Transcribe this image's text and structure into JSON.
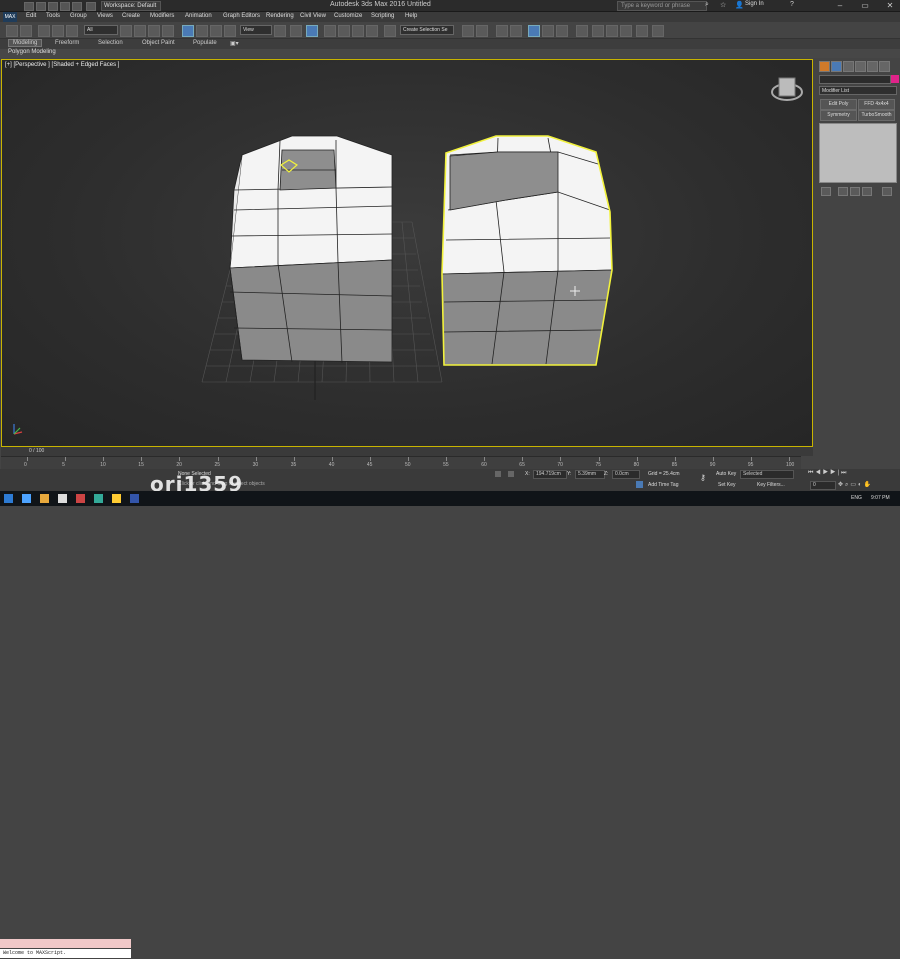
{
  "titlebar": {
    "workspace": "Workspace: Default",
    "title": "Autodesk 3ds Max 2016    Untitled",
    "search_placeholder": "Type a keyword or phrase",
    "sign_in": "Sign In"
  },
  "menu": {
    "logo": "MAX",
    "items": [
      "Edit",
      "Tools",
      "Group",
      "Views",
      "Create",
      "Modifiers",
      "Animation",
      "Graph Editors",
      "Rendering",
      "Civil View",
      "Customize",
      "Scripting",
      "Help"
    ]
  },
  "toolbar": {
    "selection_filter": "All",
    "ref_coord": "View",
    "named_sel": "Create Selection Se"
  },
  "ribbon": {
    "tabs": [
      "Modeling",
      "Freeform",
      "Selection",
      "Object Paint",
      "Populate"
    ],
    "active_tab": "Modeling",
    "sub_label": "Polygon Modeling"
  },
  "viewport": {
    "label": "[+] [Perspective ] [Shaded + Edged Faces ]",
    "border_color": "#c8b400",
    "selection_color": "#f2f23c"
  },
  "command_panel": {
    "modifier_list": "Modifier List",
    "buttons": [
      "Edit Poly",
      "FFD 4x4x4",
      "Symmetry",
      "TurboSmooth"
    ],
    "accent_color": "#e0238a"
  },
  "timeline": {
    "frame": "0 / 100",
    "ticks": [
      "0",
      "5",
      "10",
      "15",
      "20",
      "25",
      "30",
      "35",
      "40",
      "45",
      "50",
      "55",
      "60",
      "65",
      "70",
      "75",
      "80",
      "85",
      "90",
      "95",
      "100"
    ]
  },
  "status": {
    "maxscript_output": "Welcome to MAXScript.",
    "selection": "None Selected",
    "hint": "Click or click-and-drag to select objects",
    "x_label": "X:",
    "x_value": "194.719cm",
    "y_label": "Y:",
    "y_value": "5.39mm",
    "z_label": "Z:",
    "z_value": "0.0cm",
    "grid": "Grid = 25.4cm",
    "add_time_tag": "Add Time Tag",
    "auto_key": "Auto Key",
    "auto_key_value": "Selected",
    "set_key": "Set Key",
    "key_filters": "Key Filters...",
    "frame_field": "0"
  },
  "watermark": "ori1359",
  "taskbar": {
    "lang": "ENG",
    "time": "9:07 PM"
  }
}
